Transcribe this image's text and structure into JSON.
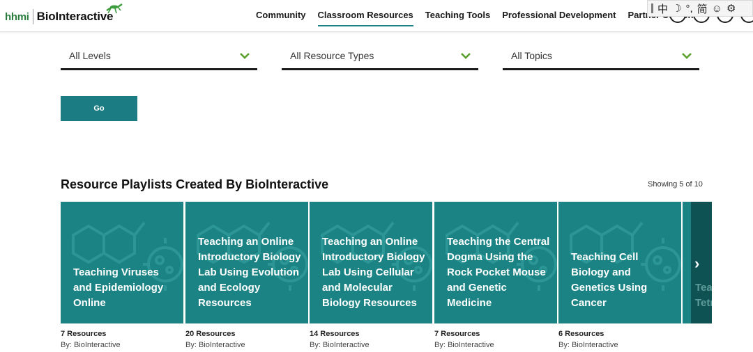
{
  "header": {
    "logo_hhmi": "hhmi",
    "logo_name": "BioInteractive",
    "nav": [
      {
        "label": "Community",
        "active": false
      },
      {
        "label": "Classroom Resources",
        "active": true
      },
      {
        "label": "Teaching Tools",
        "active": false
      },
      {
        "label": "Professional Development",
        "active": false
      },
      {
        "label": "Partner Content",
        "active": false
      }
    ],
    "icons": [
      "user-icon",
      "search-icon",
      "account-icon",
      "menu-icon"
    ]
  },
  "ime_toolbar": {
    "chars": [
      "中",
      "☽",
      "°,",
      "简",
      "☺",
      "⚙"
    ]
  },
  "filters": [
    {
      "label": "All Levels"
    },
    {
      "label": "All Resource Types"
    },
    {
      "label": "All Topics"
    }
  ],
  "go_button": "Go",
  "playlists": {
    "title": "Resource Playlists Created By BioInteractive",
    "showing": "Showing 5 of 10",
    "cards": [
      {
        "title": "Teaching Viruses and Epidemiology Online",
        "count": "7 Resources",
        "by": "By: BioInteractive"
      },
      {
        "title": "Teaching an Online Introductory Biology Lab Using Evolution and Ecology Resources",
        "count": "20 Resources",
        "by": "By: BioInteractive"
      },
      {
        "title": "Teaching an Online Introductory Biology Lab Using Cellular and Molecular Biology Resources",
        "count": "14 Resources",
        "by": "By: BioInteractive"
      },
      {
        "title": "Teaching the Central Dogma Using the Rock Pocket Mouse and Genetic Medicine",
        "count": "7 Resources",
        "by": "By: BioInteractive"
      },
      {
        "title": "Teaching Cell Biology and Genetics Using Cancer",
        "count": "6 Resources",
        "by": "By: BioInteractive"
      }
    ],
    "partial_card_title": "Tea Usi Tetr",
    "next_arrow": "›"
  },
  "colors": {
    "teal": "#1b8384",
    "brand_green": "#2a7d3e",
    "chevron_green": "#5aa02c"
  }
}
